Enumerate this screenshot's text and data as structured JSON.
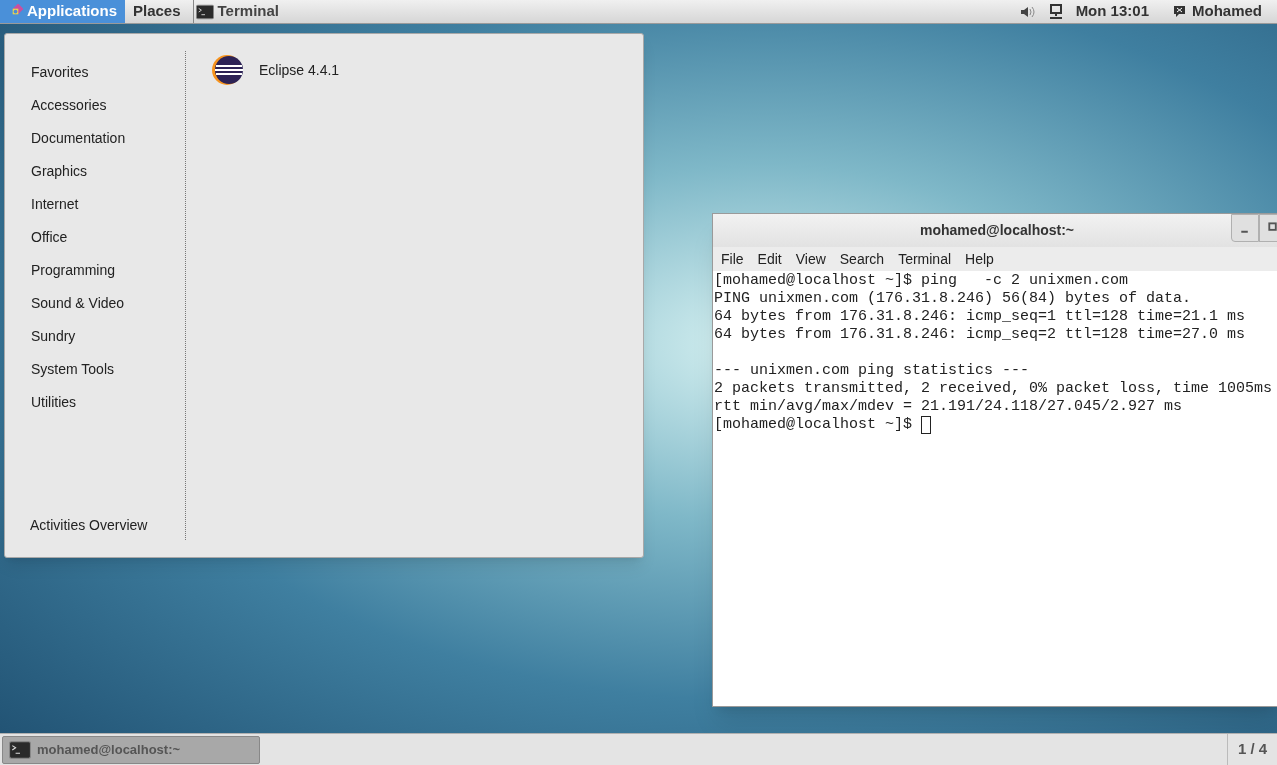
{
  "top_bar": {
    "menus": [
      {
        "label": "Applications",
        "selected": true
      },
      {
        "label": "Places",
        "selected": false
      }
    ],
    "app_menu": "Terminal",
    "clock": "Mon 13:01",
    "user": "Mohamed"
  },
  "applications_menu": {
    "categories": [
      "Favorites",
      "Accessories",
      "Documentation",
      "Graphics",
      "Internet",
      "Office",
      "Programming",
      "Sound & Video",
      "Sundry",
      "System Tools",
      "Utilities"
    ],
    "footer": "Activities Overview",
    "apps": [
      "Eclipse 4.4.1"
    ]
  },
  "terminal_window": {
    "title": "mohamed@localhost:~",
    "menu": [
      "File",
      "Edit",
      "View",
      "Search",
      "Terminal",
      "Help"
    ],
    "output_blocks": [
      [
        "[mohamed@localhost ~]$ ping   -c 2 unixmen.com",
        "PING unixmen.com (176.31.8.246) 56(84) bytes of data.",
        "64 bytes from 176.31.8.246: icmp_seq=1 ttl=128 time=21.1 ms",
        "64 bytes from 176.31.8.246: icmp_seq=2 ttl=128 time=27.0 ms"
      ],
      [
        "--- unixmen.com ping statistics ---",
        "2 packets transmitted, 2 received, 0% packet loss, time 1005ms",
        "rtt min/avg/max/mdev = 21.191/24.118/27.045/2.927 ms",
        "[mohamed@localhost ~]$ "
      ]
    ],
    "cursor_visible": true
  },
  "bottom_bar": {
    "tasks": [
      {
        "label": "mohamed@localhost:~",
        "selected": false
      }
    ],
    "workspace": "1 / 4"
  }
}
